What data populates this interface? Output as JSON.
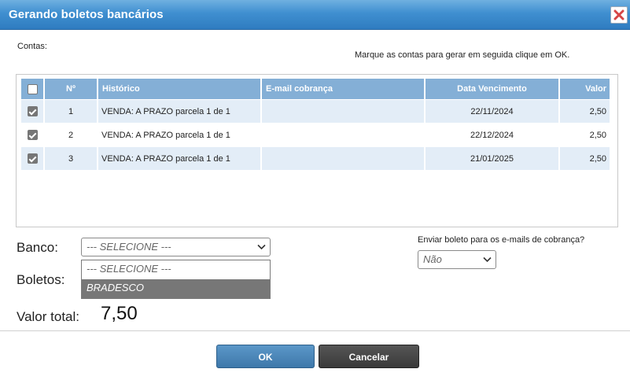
{
  "dialog": {
    "title": "Gerando boletos bancários"
  },
  "labels": {
    "contas": "Contas:",
    "instruction": "Marque as contas para gerar em seguida clique em OK.",
    "banco": "Banco:",
    "boletos": "Boletos:",
    "valor_total": "Valor total:",
    "enviar": "Enviar boleto para os e-mails de cobrança?"
  },
  "table": {
    "headers": {
      "no": "Nº",
      "historico": "Histórico",
      "email": "E-mail cobrança",
      "data": "Data Vencimento",
      "valor": "Valor"
    },
    "select_all_checked": false,
    "rows": [
      {
        "checked": true,
        "no": "1",
        "historico": "VENDA: A PRAZO parcela 1 de 1",
        "email": "",
        "data": "22/11/2024",
        "valor": "2,50"
      },
      {
        "checked": true,
        "no": "2",
        "historico": "VENDA: A PRAZO parcela 1 de 1",
        "email": "",
        "data": "22/12/2024",
        "valor": "2,50"
      },
      {
        "checked": true,
        "no": "3",
        "historico": "VENDA: A PRAZO parcela 1 de 1",
        "email": "",
        "data": "21/01/2025",
        "valor": "2,50"
      }
    ]
  },
  "banco_select": {
    "value": "--- SELECIONE ---",
    "options": [
      "--- SELECIONE ---",
      "BRADESCO"
    ],
    "highlighted": "BRADESCO"
  },
  "valor_total": "7,50",
  "enviar_select": {
    "value": "Não"
  },
  "buttons": {
    "ok": "OK",
    "cancel": "Cancelar"
  },
  "icons": {
    "close": "close-icon",
    "dropdown": "chevron-down-icon"
  },
  "colors": {
    "titlebar": "#3f8fd0",
    "header": "#84afd6",
    "row_alt": "#e3edf7",
    "ok": "#4a86b8",
    "cancel": "#444444",
    "close": "#d9534f"
  }
}
